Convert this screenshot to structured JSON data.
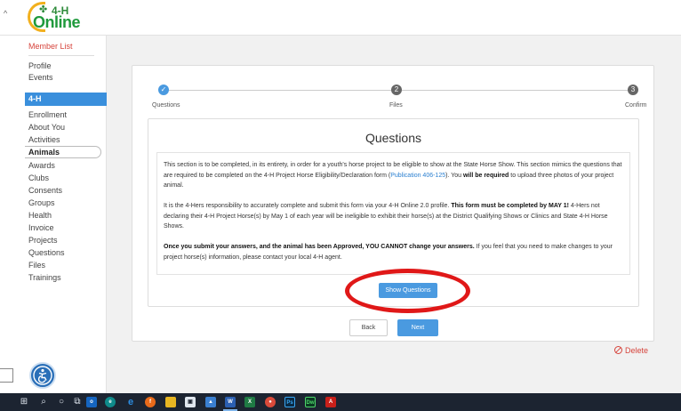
{
  "header": {
    "logo_text": "4-H",
    "logo_online": "Online",
    "icons": [
      "collapse-caret-icon",
      "clover-icon"
    ]
  },
  "sidebar": {
    "member_list": "Member List",
    "items_top": [
      "Profile",
      "Events"
    ],
    "active": "4-H",
    "items": [
      "Enrollment",
      "About You",
      "Activities"
    ],
    "selected": "Animals",
    "items_bottom": [
      "Awards",
      "Clubs",
      "Consents",
      "Groups",
      "Health",
      "Invoice",
      "Projects",
      "Questions",
      "Files",
      "Trainings"
    ]
  },
  "stepper": {
    "steps": [
      {
        "num": "✓",
        "label": "Questions",
        "state": "done"
      },
      {
        "num": "2",
        "label": "Files",
        "state": "todo"
      },
      {
        "num": "3",
        "label": "Confirm",
        "state": "todo"
      }
    ]
  },
  "questions": {
    "title": "Questions",
    "p1_a": "This section is to be completed, in its entirety, in order for a youth's horse project to be eligible to show at the State Horse Show. This section mimics the questions that are required to be completed on the 4-H Project Horse Eligibility/Declaration form (",
    "p1_link": "Publication 406-125",
    "p1_b": "). You ",
    "p1_bold": "will be required",
    "p1_c": " to upload three photos of your project animal.",
    "p2_a": "It is the 4-Hers responsibility to accurately complete and submit this form via your 4-H Online 2.0 profile. ",
    "p2_bold": "This form must be completed by MAY 1!",
    "p2_b": " 4-Hers not declaring their 4-H Project Horse(s) by May 1 of each year will be ineligible to exhibit their horse(s) at the District Qualifying Shows or Clinics and State 4-H Horse Shows.",
    "p3_bold": "Once you submit your answers, and the animal has been Approved, YOU CANNOT change your answers.",
    "p3_a": " If you feel that you need to make changes to your project horse(s) information, please contact your local 4-H agent.",
    "show_button": "Show Questions"
  },
  "actions": {
    "back": "Back",
    "next": "Next",
    "delete": "Delete"
  },
  "taskbar": {
    "icons": [
      "windows-start-icon",
      "search-icon",
      "cortana-icon",
      "task-view-icon",
      "outlook-icon",
      "edge-chromium-icon",
      "edge-icon",
      "firefox-icon",
      "file-explorer-icon",
      "store-icon",
      "photos-icon",
      "word-icon",
      "excel-icon",
      "chrome-icon",
      "photoshop-icon",
      "dreamweaver-icon",
      "acrobat-icon"
    ]
  },
  "colors": {
    "accent_blue": "#4a9ae0",
    "sidebar_active": "#3a8fdc",
    "alert_red": "#d6443c",
    "annotation_red": "#e01818",
    "brand_green": "#1f9a3c",
    "taskbar": "#1c2431"
  }
}
